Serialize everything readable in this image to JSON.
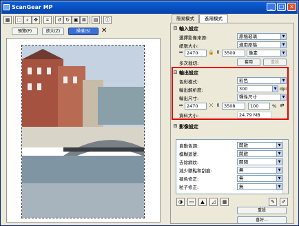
{
  "title": "ScanGear MP",
  "toolbar": {
    "preview_label": "預覽(P)",
    "zoom_label": "放大(Z)",
    "scan_label": "掃描(S)",
    "close_mark": "✕"
  },
  "tabs": [
    {
      "label": "簡易模式"
    },
    {
      "label": "進階模式"
    }
  ],
  "input": {
    "heading": "輸入設定",
    "source_label": "選擇影像來源:",
    "source_value": "原稿玻璃",
    "paper_label": "紙張大小:",
    "paper_value": "適用原稿",
    "width": "2470",
    "height": "3500",
    "unit": "像素",
    "multi_label": "多次裁切:",
    "apply_label": "套用",
    "reset_label": "重設"
  },
  "output": {
    "heading": "輸出設定",
    "color_label": "色彩模式:",
    "color_value": "彩色",
    "res_label": "輸出解析度:",
    "res_value": "300",
    "res_unit": "dpi",
    "size_label": "輸出尺寸:",
    "size_value": "彈性尺寸",
    "width": "2470",
    "height": "3508",
    "scale": "100",
    "scale_unit": "%",
    "data_label": "資料大小:",
    "data_value": "24.79 MB"
  },
  "image": {
    "heading": "影像設定",
    "rows": [
      {
        "label": "自動色調:",
        "value": "開啟"
      },
      {
        "label": "模糊遮罩:",
        "value": "開啟"
      },
      {
        "label": "去除網紋:",
        "value": "關閉"
      },
      {
        "label": "減少髒點和刮痕:",
        "value": "無"
      },
      {
        "label": "褪色修正:",
        "value": "無"
      },
      {
        "label": "粒子修正:",
        "value": "無"
      }
    ]
  },
  "bottom": {
    "reset_label": "重設",
    "prefs_label": "喜好..."
  }
}
